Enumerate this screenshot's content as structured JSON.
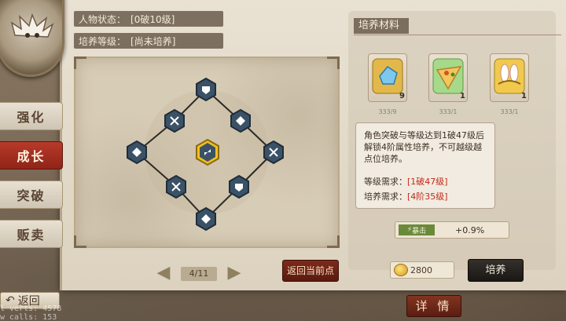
{
  "status": {
    "character_label": "人物状态：",
    "character_value": "[0破10级]",
    "cultivation_label": "培养等级：",
    "cultivation_value": "[尚未培养]"
  },
  "side_menu": {
    "items": [
      {
        "label": "强化",
        "active": false
      },
      {
        "label": "成长",
        "active": true
      },
      {
        "label": "突破",
        "active": false
      },
      {
        "label": "贩卖",
        "active": false
      }
    ]
  },
  "pager": {
    "label": "4/11"
  },
  "buttons": {
    "return_current": "返回当前点",
    "cultivate": "培养",
    "back": "返回",
    "detail": "详 情"
  },
  "materials": {
    "title": "培养材料",
    "items": [
      {
        "icon": "crystal-icon",
        "count": "333/9",
        "num": "9",
        "frame_color": "#c7a3e5"
      },
      {
        "icon": "pizza-icon",
        "count": "333/1",
        "num": "1",
        "frame_color": "#c7a3e5"
      },
      {
        "icon": "bunny-ears-icon",
        "count": "333/1",
        "num": "1",
        "frame_color": "#c7a3e5"
      }
    ]
  },
  "description": {
    "text": "角色突破与等级达到1破47级后解锁4阶属性培养，不可越级越点位培养。",
    "level_req_label": "等级需求：",
    "level_req_value": "[1破47级]",
    "cultivation_req_label": "培养需求：",
    "cultivation_req_value": "[4阶35级]"
  },
  "stat": {
    "tag": "暴击",
    "value": "+0.9%"
  },
  "currency": {
    "amount": "2800"
  },
  "debug": {
    "line1": "l verts:  4578",
    "line2": "w calls:  153"
  },
  "colors": {
    "active_tab": "#b83a2a",
    "selected_node": "#f0c020",
    "node_fill": "#3b5266",
    "warning_red": "#c32a17"
  }
}
